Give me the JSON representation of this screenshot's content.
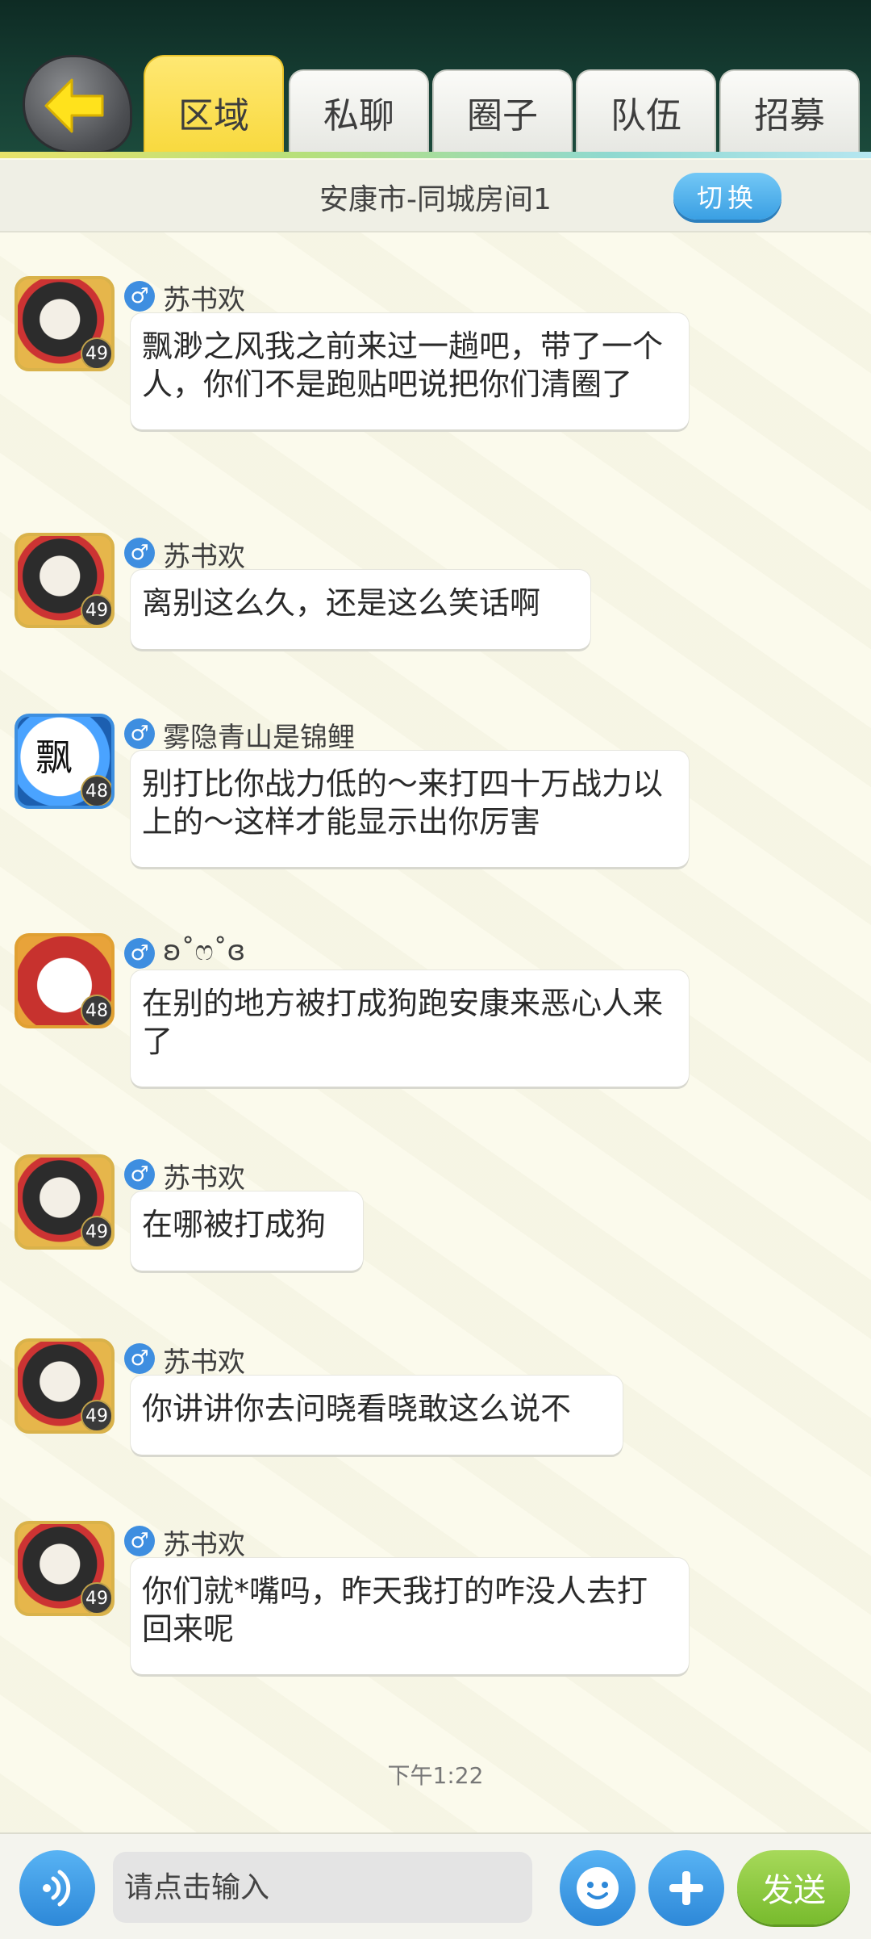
{
  "tabs": [
    {
      "label": "区域",
      "active": true
    },
    {
      "label": "私聊",
      "active": false
    },
    {
      "label": "圈子",
      "active": false
    },
    {
      "label": "队伍",
      "active": false
    },
    {
      "label": "招募",
      "active": false
    }
  ],
  "room": {
    "title": "安康市-同城房间1",
    "switch_label": "切换"
  },
  "messages": [
    {
      "name": "苏书欢",
      "gender": "♂",
      "level": "49",
      "text": "飘渺之风我之前来过一趟吧，带了一个人，你们不是跑贴吧说把你们清圈了"
    },
    {
      "name": "苏书欢",
      "gender": "♂",
      "level": "49",
      "text": "离别这么久，还是这么笑话啊"
    },
    {
      "name": "雾隐青山是锦鲤",
      "gender": "♂",
      "level": "48",
      "text": "别打比你战力低的～来打四十万战力以上的～这样才能显示出你厉害",
      "avatar_glyph": "飘"
    },
    {
      "name": "ʚ˚ෆ˚ɞ",
      "gender": "♂",
      "level": "48",
      "text": "在别的地方被打成狗跑安康来恶心人来了"
    },
    {
      "name": "苏书欢",
      "gender": "♂",
      "level": "49",
      "text": "在哪被打成狗"
    },
    {
      "name": "苏书欢",
      "gender": "♂",
      "level": "49",
      "text": "你讲讲你去问晓看晓敢这么说不"
    },
    {
      "name": "苏书欢",
      "gender": "♂",
      "level": "49",
      "text": "你们就*嘴吗，昨天我打的咋没人去打回来呢"
    }
  ],
  "timestamp": "下午1:22",
  "input": {
    "placeholder": "请点击输入",
    "send_label": "发送"
  },
  "colors": {
    "active_tab": "#f8d93e",
    "accent_blue": "#3a9fe3",
    "send_green": "#78bb2d"
  },
  "icons": {
    "back": "back-arrow-icon",
    "voice": "voice-icon",
    "emoji": "emoji-icon",
    "plus": "plus-icon"
  }
}
